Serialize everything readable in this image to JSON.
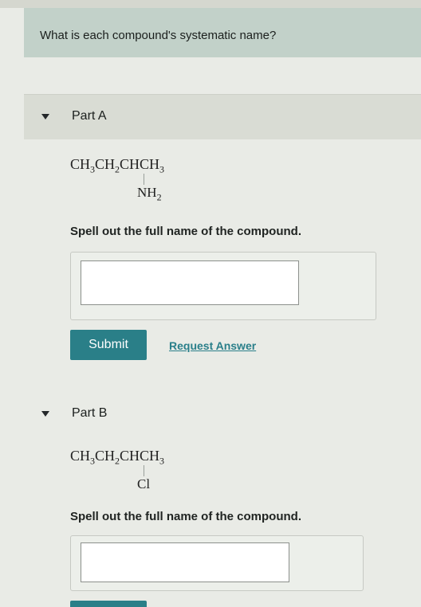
{
  "question": {
    "text": "What is each compound's systematic name?"
  },
  "part_a": {
    "label": "Part A",
    "formula": {
      "ch3_1": "CH",
      "sub3_1": "3",
      "ch2": "CH",
      "sub2": "2",
      "chch3": "CHCH",
      "sub3_2": "3"
    },
    "substituent": {
      "main": "NH",
      "sub": "2"
    },
    "instruction": "Spell out the full name of the compound.",
    "answer_value": "",
    "submit_label": "Submit",
    "request_label": "Request Answer"
  },
  "part_b": {
    "label": "Part B",
    "formula": {
      "ch3_1": "CH",
      "sub3_1": "3",
      "ch2": "CH",
      "sub2": "2",
      "chch3": "CHCH",
      "sub3_2": "3"
    },
    "substituent": {
      "main": "Cl"
    },
    "instruction": "Spell out the full name of the compound.",
    "answer_value": ""
  },
  "colors": {
    "accent": "#2a7f88",
    "link": "#2a7f8a",
    "banner": "#c2d1c9"
  }
}
